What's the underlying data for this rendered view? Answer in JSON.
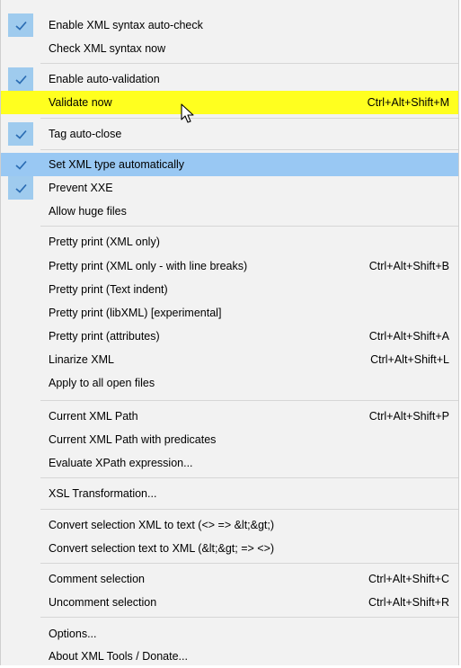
{
  "menu": {
    "items": [
      {
        "label": "Enable XML syntax auto-check",
        "shortcut": "",
        "checked": true
      },
      {
        "label": "Check XML syntax now",
        "shortcut": "",
        "checked": false
      },
      {
        "label": "Enable auto-validation",
        "shortcut": "",
        "checked": true
      },
      {
        "label": "Validate now",
        "shortcut": "Ctrl+Alt+Shift+M",
        "checked": false
      },
      {
        "label": "Tag auto-close",
        "shortcut": "",
        "checked": true
      },
      {
        "label": "Set XML type automatically",
        "shortcut": "",
        "checked": true
      },
      {
        "label": "Prevent XXE",
        "shortcut": "",
        "checked": true
      },
      {
        "label": "Allow huge files",
        "shortcut": "",
        "checked": false
      },
      {
        "label": "Pretty print (XML only)",
        "shortcut": "",
        "checked": false
      },
      {
        "label": "Pretty print (XML only - with line breaks)",
        "shortcut": "Ctrl+Alt+Shift+B",
        "checked": false
      },
      {
        "label": "Pretty print (Text indent)",
        "shortcut": "",
        "checked": false
      },
      {
        "label": "Pretty print (libXML) [experimental]",
        "shortcut": "",
        "checked": false
      },
      {
        "label": "Pretty print (attributes)",
        "shortcut": "Ctrl+Alt+Shift+A",
        "checked": false
      },
      {
        "label": "Linarize XML",
        "shortcut": "Ctrl+Alt+Shift+L",
        "checked": false
      },
      {
        "label": "Apply to all open files",
        "shortcut": "",
        "checked": false
      },
      {
        "label": "Current XML Path",
        "shortcut": "Ctrl+Alt+Shift+P",
        "checked": false
      },
      {
        "label": "Current XML Path with predicates",
        "shortcut": "",
        "checked": false
      },
      {
        "label": "Evaluate XPath expression...",
        "shortcut": "",
        "checked": false
      },
      {
        "label": "XSL Transformation...",
        "shortcut": "",
        "checked": false
      },
      {
        "label": "Convert selection XML to text (<> => &lt;&gt;)",
        "shortcut": "",
        "checked": false
      },
      {
        "label": "Convert selection text to XML (&lt;&gt; => <>)",
        "shortcut": "",
        "checked": false
      },
      {
        "label": "Comment selection",
        "shortcut": "Ctrl+Alt+Shift+C",
        "checked": false
      },
      {
        "label": "Uncomment selection",
        "shortcut": "Ctrl+Alt+Shift+R",
        "checked": false
      },
      {
        "label": "Options...",
        "shortcut": "",
        "checked": false
      },
      {
        "label": "About XML Tools / Donate...",
        "shortcut": "",
        "checked": false
      }
    ],
    "selected_index": 5,
    "highlighted_index": 3
  },
  "icons": {
    "check": "checkmark-icon",
    "cursor": "mouse-pointer-icon"
  },
  "colors": {
    "menu_background": "#f2f2f2",
    "check_background": "#9fcbee",
    "selected_row": "#99c8f3",
    "highlight_row": "#ffff1f",
    "check_mark": "#2a6cb3"
  }
}
